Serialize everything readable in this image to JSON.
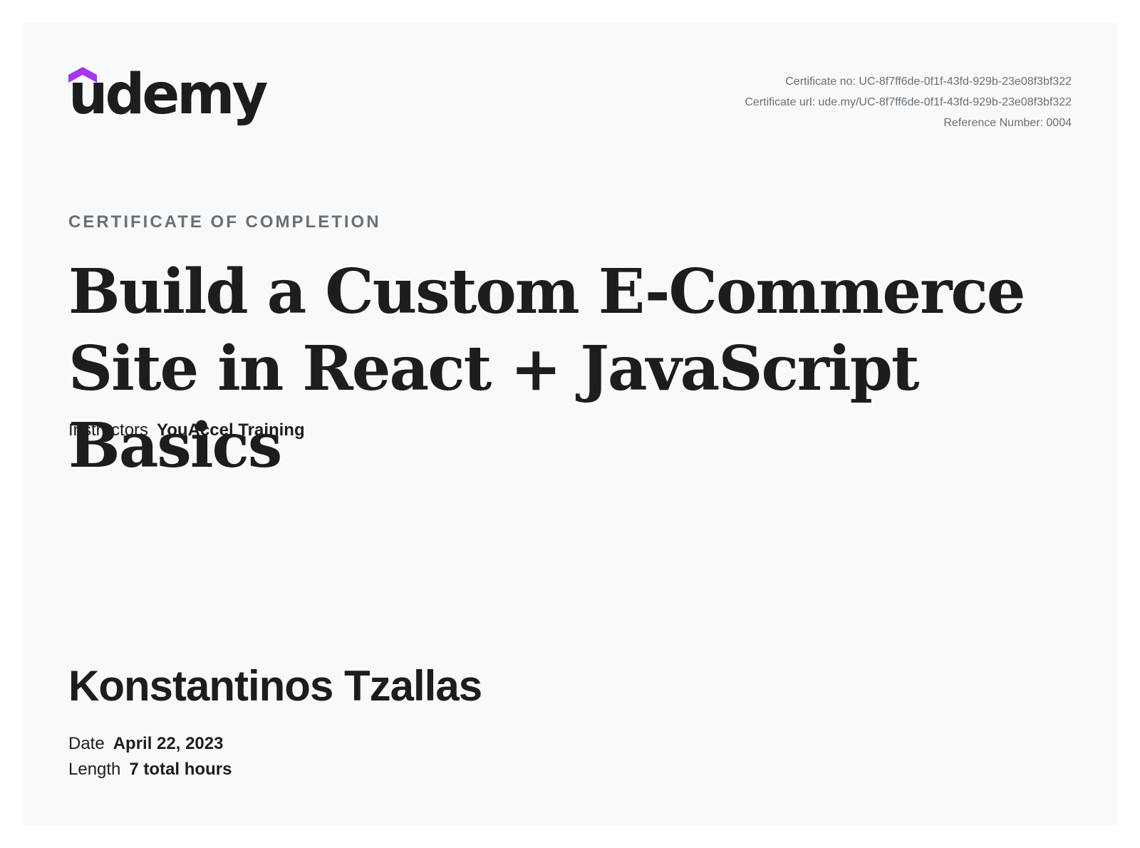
{
  "brand": {
    "name": "udemy",
    "accent_color": "#a435f0",
    "logo_icon": "udemy-chevron-icon"
  },
  "meta": {
    "certificate_no": "Certificate no: UC-8f7ff6de-0f1f-43fd-929b-23e08f3bf322",
    "certificate_url": "Certificate url: ude.my/UC-8f7ff6de-0f1f-43fd-929b-23e08f3bf322",
    "reference_number": "Reference Number: 0004"
  },
  "certificate": {
    "label": "CERTIFICATE OF COMPLETION",
    "course_title": "Build a Custom E-Commerce Site in React + JavaScript Basics",
    "instructors_label": "Instructors",
    "instructors_value": "YouAccel Training",
    "student_name": "Konstantinos Tzallas",
    "date_label": "Date",
    "date_value": "April 22, 2023",
    "length_label": "Length",
    "length_value": "7 total hours"
  },
  "colors": {
    "background": "#f7f9fa",
    "text": "#1c1d1f",
    "muted": "#6a6f73"
  }
}
